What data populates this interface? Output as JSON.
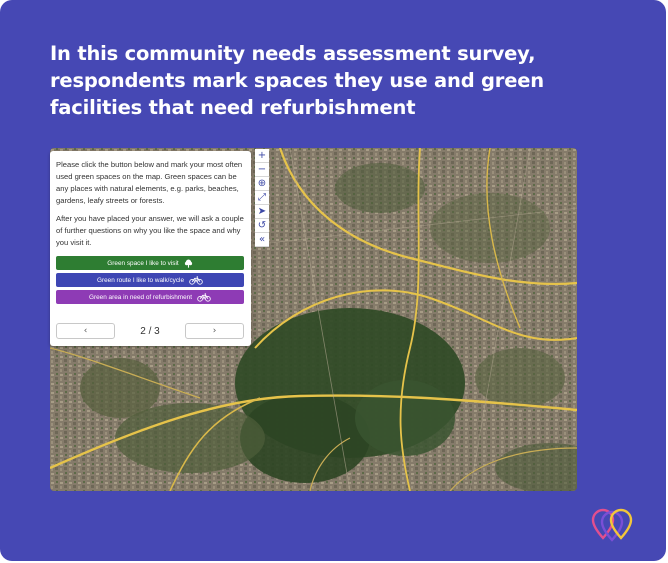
{
  "headline": "In this community needs assessment survey, respondents mark spaces they use and green facilities that need refurbishment",
  "survey": {
    "paragraph_1": "Please click the button below and mark your most often used green spaces on the map. Green spaces can be any places with natural elements, e.g. parks, beaches, gardens, leafy streets or forests.",
    "paragraph_2": "After you have placed your answer, we will ask a couple of further questions on why you like the space and why you visit it.",
    "buttons": [
      {
        "label": "Green space I like to visit",
        "icon": "tree-icon",
        "color": "#2e7d32"
      },
      {
        "label": "Green route I like to walk/cycle",
        "icon": "bike-icon",
        "color": "#3e46b3"
      },
      {
        "label": "Green area in need of refurbishment",
        "icon": "bike-icon",
        "color": "#8e3bb5"
      }
    ],
    "pager": {
      "prev": "‹",
      "label": "2 / 3",
      "next": "›"
    }
  },
  "map_controls": [
    {
      "icon": "zoom-in-icon",
      "glyph": "+"
    },
    {
      "icon": "zoom-out-icon",
      "glyph": "−"
    },
    {
      "icon": "zoom-search-icon",
      "glyph": "⊕"
    },
    {
      "icon": "fullscreen-icon",
      "glyph": "⤢"
    },
    {
      "icon": "locate-icon",
      "glyph": "➤"
    },
    {
      "icon": "reset-icon",
      "glyph": "↺"
    },
    {
      "icon": "collapse-icon",
      "glyph": "«"
    }
  ],
  "colors": {
    "background": "#4648b4",
    "headline_text": "#ffffff",
    "primary": "#3e46b3"
  }
}
